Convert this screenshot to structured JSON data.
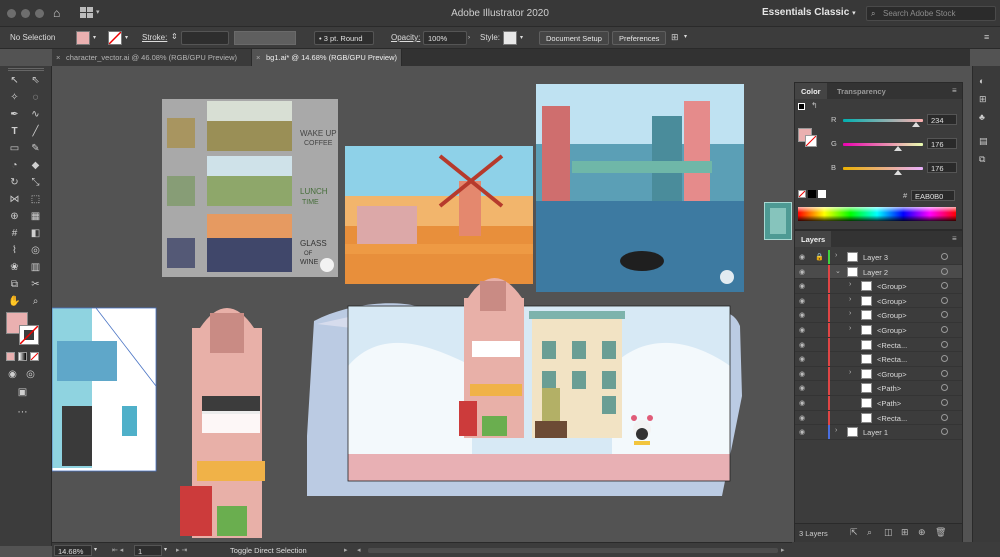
{
  "window": {
    "title": "Adobe Illustrator 2020"
  },
  "header": {
    "workspace_label": "Essentials Classic",
    "search_placeholder": "Search Adobe Stock"
  },
  "control_bar": {
    "selection_label": "No Selection",
    "stroke_label": "Stroke:",
    "brush_label": "3 pt. Round",
    "opacity_label": "Opacity:",
    "opacity_value": "100%",
    "style_label": "Style:",
    "document_setup_label": "Document Setup",
    "preferences_label": "Preferences",
    "fill_color": "#EAB0B0"
  },
  "tabs": [
    {
      "label": "character_vector.ai @ 46.08% (RGB/GPU Preview)",
      "active": false
    },
    {
      "label": "bg1.ai* @ 14.68% (RGB/GPU Preview)",
      "active": true
    }
  ],
  "color_panel": {
    "tabs": [
      "Color",
      "Transparency"
    ],
    "channels": [
      {
        "label": "R",
        "value": "234",
        "fraction": 0.918
      },
      {
        "label": "G",
        "value": "176",
        "fraction": 0.69
      },
      {
        "label": "B",
        "value": "176",
        "fraction": 0.69
      }
    ],
    "hex_prefix": "#",
    "hex_value": "EAB0B0",
    "current_color": "#EAB0B0"
  },
  "layers_panel": {
    "title": "Layers",
    "rows": [
      {
        "name": "Layer 3",
        "color": "#3fd13f",
        "selected": false
      },
      {
        "name": "Layer 2",
        "color": "#e04545",
        "selected": true
      },
      {
        "name": "<Group>",
        "color": "#e04545",
        "selected": false
      },
      {
        "name": "<Group>",
        "color": "#e04545",
        "selected": false
      },
      {
        "name": "<Group>",
        "color": "#e04545",
        "selected": false
      },
      {
        "name": "<Group>",
        "color": "#e04545",
        "selected": false
      },
      {
        "name": "<Recta...",
        "color": "#e04545",
        "selected": false
      },
      {
        "name": "<Recta...",
        "color": "#e04545",
        "selected": false
      },
      {
        "name": "<Group>",
        "color": "#e04545",
        "selected": false
      },
      {
        "name": "<Path>",
        "color": "#e04545",
        "selected": false
      },
      {
        "name": "<Path>",
        "color": "#e04545",
        "selected": false
      },
      {
        "name": "<Recta...",
        "color": "#e04545",
        "selected": false
      },
      {
        "name": "Layer 1",
        "color": "#4a6fe0",
        "selected": false
      }
    ],
    "footer_count": "3 Layers"
  },
  "status_bar": {
    "zoom": "14.68%",
    "artboard": "1",
    "status_text": "Toggle Direct Selection"
  }
}
